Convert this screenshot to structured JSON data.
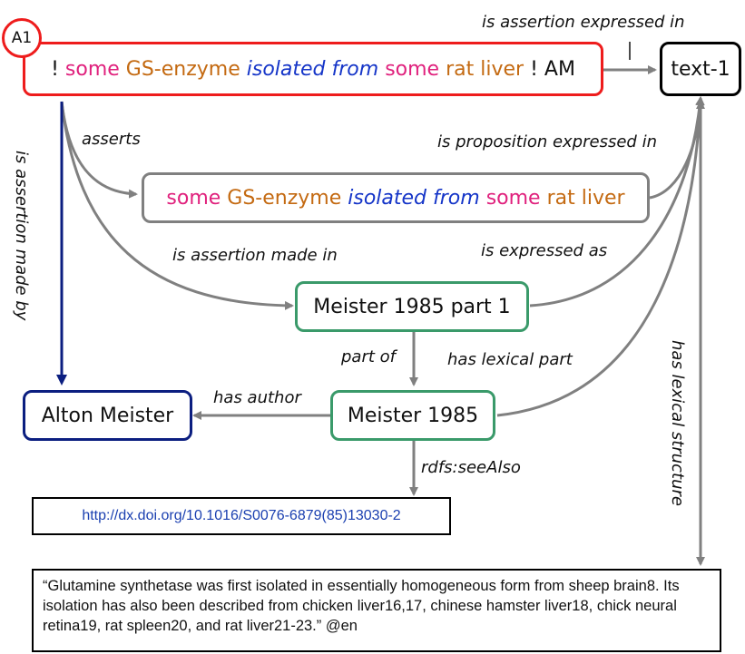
{
  "badge": "A1",
  "assertion": {
    "prefix": "!",
    "some1": "some",
    "enzyme": "GS-enzyme",
    "isolated": "isolated from",
    "some2": "some",
    "liver": "rat liver",
    "suffix": "! AM"
  },
  "proposition": {
    "some1": "some",
    "enzyme": "GS-enzyme",
    "isolated": "isolated from",
    "some2": "some",
    "liver": "rat liver"
  },
  "nodes": {
    "text1": "text-1",
    "part1": "Meister 1985 part 1",
    "meister1985": "Meister 1985",
    "author": "Alton Meister",
    "doi": "http://dx.doi.org/10.1016/S0076-6879(85)13030-2",
    "quote": "“Glutamine synthetase was first isolated in essentially homogeneous form from sheep brain8. Its isolation has also been described from chicken liver16,17, chinese hamster liver18, chick neural retina19, rat spleen20, and rat liver21-23.” @en"
  },
  "edges": {
    "assertion_expressed_in": "is assertion expressed in",
    "assertion_expressed_in_mark": "|",
    "asserts": "asserts",
    "proposition_expressed_in": "is proposition expressed in",
    "assertion_made_in": "is assertion made in",
    "expressed_as": "is expressed as",
    "assertion_made_by": "is assertion made by",
    "part_of": "part of",
    "has_lexical_part": "has lexical part",
    "has_author": "has author",
    "has_lexical_structure": "has lexical structure",
    "see_also": "rdfs:seeAlso"
  },
  "colors": {
    "red": "#ee1c1c",
    "gray": "#808080",
    "green": "#3a9a6a",
    "navy": "#0b1e80",
    "black": "#000000",
    "pink": "#e0217d",
    "orange": "#c46a12",
    "blue": "#1535c8",
    "link": "#1a3fb0"
  }
}
